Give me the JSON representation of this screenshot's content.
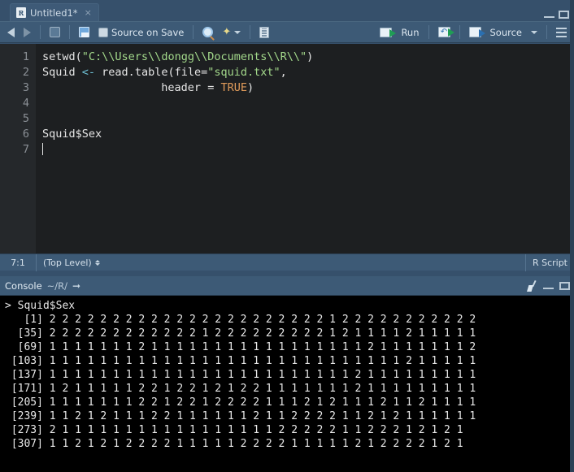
{
  "window": {
    "minimize_label": "—",
    "maximize_label": "□"
  },
  "source_pane": {
    "tab": {
      "icon": "r-script-icon",
      "label": "Untitled1*",
      "close_label": "×"
    },
    "toolbar": {
      "back_label": "",
      "forward_label": "",
      "popout_label": "",
      "save_label": "",
      "source_on_save_label": "Source on Save",
      "find_label": "",
      "magic_label": "",
      "magic_caret_label": "",
      "outline_label": "",
      "run_label": "Run",
      "rerun_label": "",
      "source_label": "Source",
      "source_caret_label": "",
      "panel_layout_label": ""
    },
    "editor": {
      "line_numbers": [
        "1",
        "2",
        "3",
        "4",
        "5",
        "6",
        "7"
      ],
      "lines": [
        {
          "tokens": [
            {
              "t": "setwd(",
              "c": "plain"
            },
            {
              "t": "\"C:\\\\Users\\\\dongg\\\\Documents\\\\R\\\\\"",
              "c": "str"
            },
            {
              "t": ")",
              "c": "plain"
            }
          ]
        },
        {
          "tokens": [
            {
              "t": "Squid ",
              "c": "plain"
            },
            {
              "t": "<-",
              "c": "op"
            },
            {
              "t": " read.table(file=",
              "c": "plain"
            },
            {
              "t": "\"squid.txt\"",
              "c": "str"
            },
            {
              "t": ",",
              "c": "plain"
            }
          ]
        },
        {
          "tokens": [
            {
              "t": "                  header = ",
              "c": "plain"
            },
            {
              "t": "TRUE",
              "c": "num"
            },
            {
              "t": ")",
              "c": "plain"
            }
          ]
        },
        {
          "tokens": []
        },
        {
          "tokens": []
        },
        {
          "tokens": [
            {
              "t": "Squid",
              "c": "plain"
            },
            {
              "t": "$Sex",
              "c": "plain"
            }
          ]
        },
        {
          "tokens": []
        }
      ]
    },
    "statusbar": {
      "cursor_position": "7:1",
      "scope": "(Top Level)",
      "file_type": "R Script"
    }
  },
  "console_pane": {
    "header": {
      "title": "Console",
      "path": "~/R/",
      "popout_icon": "popout-icon",
      "clear_icon": "broom-icon",
      "minimize_label": "—",
      "maximize_label": "□"
    },
    "output": {
      "command_prompt": ">",
      "command": "Squid$Sex",
      "rows": [
        {
          "index": "[1]",
          "values": "2 2 2 2 2 2 2 2 2 2 2 2 2 2 2 2 2 2 2 2 2 2 1 2 2 2 2 2 2 2 2 2 2 2"
        },
        {
          "index": "[35]",
          "values": "2 2 2 2 2 2 2 2 2 2 2 2 1 2 2 2 2 2 2 2 2 2 1 2 1 1 1 1 2 1 1 1 1 1"
        },
        {
          "index": "[69]",
          "values": "1 1 1 1 1 1 1 2 1 1 1 1 1 1 1 1 1 1 1 1 1 1 1 1 1 2 1 1 1 1 1 1 1 2"
        },
        {
          "index": "[103]",
          "values": "1 1 1 1 1 1 1 1 1 1 1 1 1 1 1 1 1 1 1 1 1 1 1 1 1 1 1 1 2 1 1 1 1 1"
        },
        {
          "index": "[137]",
          "values": "1 1 1 1 1 1 1 1 1 1 1 1 1 1 1 1 1 1 1 1 1 1 1 1 2 1 1 1 1 1 1 1 1 1"
        },
        {
          "index": "[171]",
          "values": "1 2 1 1 1 1 1 2 2 1 2 2 1 2 1 2 2 1 1 1 1 1 1 1 2 1 1 1 1 1 1 1 1 1"
        },
        {
          "index": "[205]",
          "values": "1 1 1 1 1 1 1 2 2 1 2 2 1 2 2 2 2 1 1 1 2 1 2 1 1 1 2 1 1 2 1 1 1 1"
        },
        {
          "index": "[239]",
          "values": "1 1 2 1 2 1 1 1 2 2 1 1 1 1 1 1 2 1 1 2 2 2 2 1 1 2 1 2 1 1 1 1 1 1"
        },
        {
          "index": "[273]",
          "values": "2 1 1 1 1 1 1 1 1 1 1 1 1 1 1 1 1 1 2 2 2 2 2 1 1 2 2 2 1 2 1 2 1"
        },
        {
          "index": "[307]",
          "values": "1 1 2 1 2 1 2 2 2 2 1 1 1 1 1 2 2 2 2 1 1 1 1 1 2 1 2 2 2 2 1 2 1"
        }
      ]
    }
  },
  "colors": {
    "chrome": "#3d5a76",
    "editor_bg": "#1d1f21",
    "console_bg": "#000000",
    "string": "#a3d98b",
    "constant": "#e09b5a",
    "operator": "#6fc2d6",
    "run_green": "#1f9d55"
  }
}
